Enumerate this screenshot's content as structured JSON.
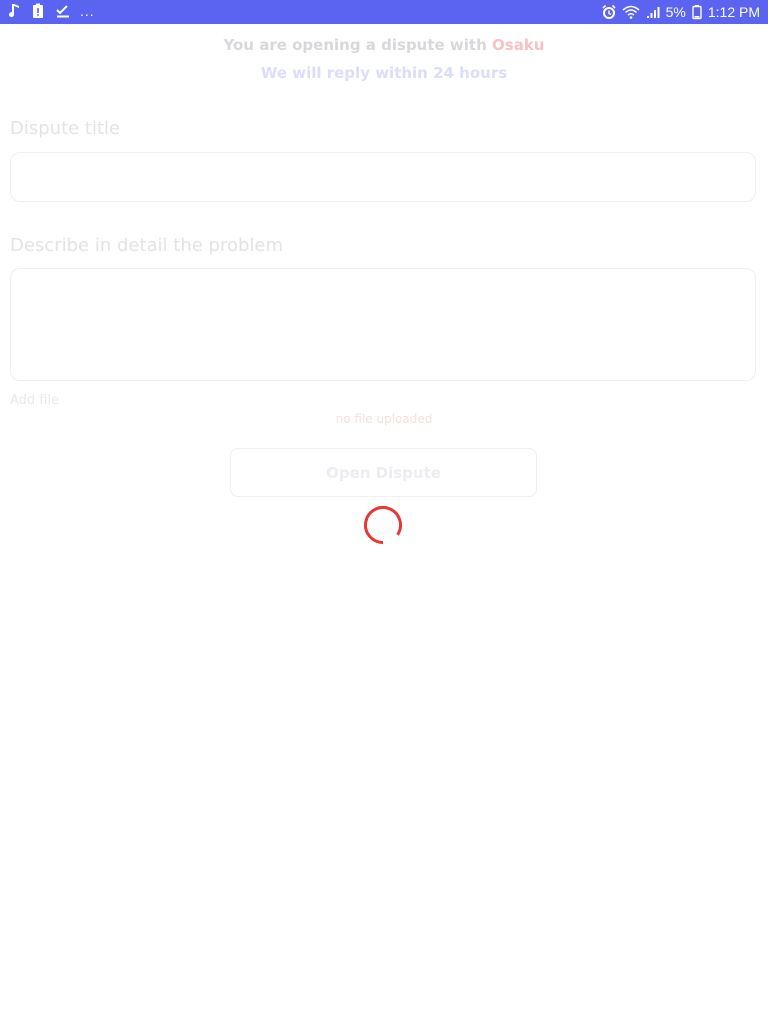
{
  "status_bar": {
    "left_icons": [
      "music-note-icon",
      "battery-alert-icon",
      "checklist-icon"
    ],
    "more_label": "...",
    "battery_percent": "5%",
    "time": "1:12 PM",
    "background": "#5a64f0"
  },
  "dispute": {
    "intro_text": "You are opening a dispute with",
    "counterpart": "Osaku",
    "reply_note": "We will reply within 24 hours",
    "title_label": "Dispute title",
    "title_value": "",
    "description_label": "Describe in detail the problem",
    "description_value": "",
    "add_file_label": "Add file",
    "file_status": "no file uploaded",
    "submit_label": "Open Dispute"
  },
  "colors": {
    "accent": "#e53935",
    "status_bar": "#5a64f0"
  },
  "loading": true
}
